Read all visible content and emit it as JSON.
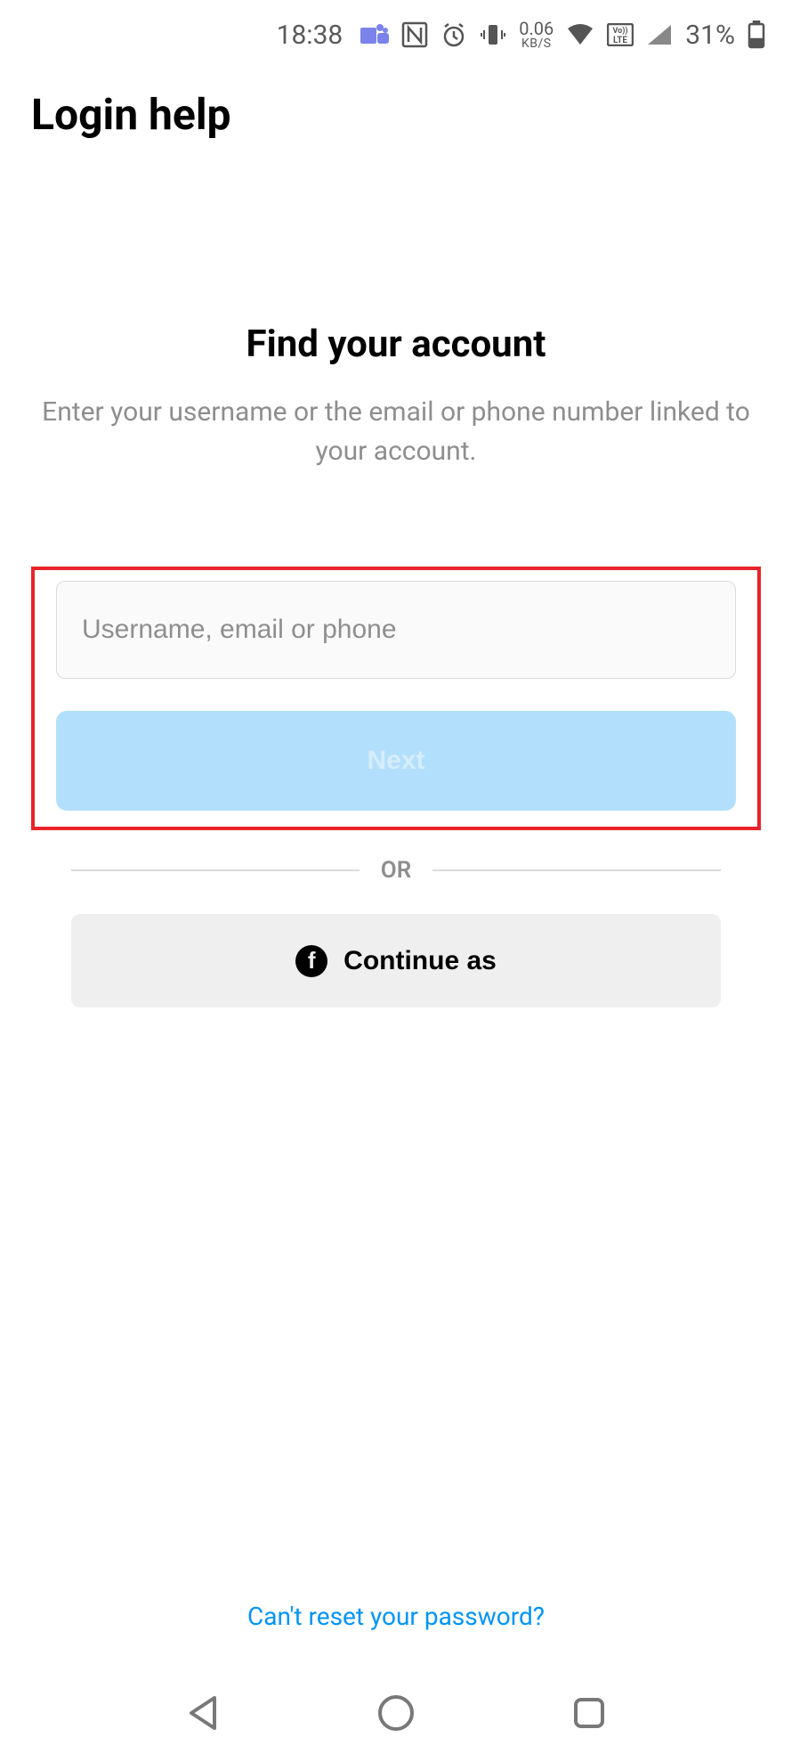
{
  "status_bar": {
    "time": "18:38",
    "data_rate_value": "0.06",
    "data_rate_unit": "KB/S",
    "volte": "Vo\nLTE",
    "battery_pct": "31%"
  },
  "header": {
    "title": "Login help"
  },
  "main": {
    "heading": "Find your account",
    "subheading": "Enter your username or the email or phone number linked to your account."
  },
  "form": {
    "input_placeholder": "Username, email or phone",
    "input_value": "",
    "next_label": "Next"
  },
  "divider": {
    "or_label": "OR"
  },
  "facebook": {
    "label": "Continue as"
  },
  "footer": {
    "link_label": "Can't reset your password?"
  }
}
